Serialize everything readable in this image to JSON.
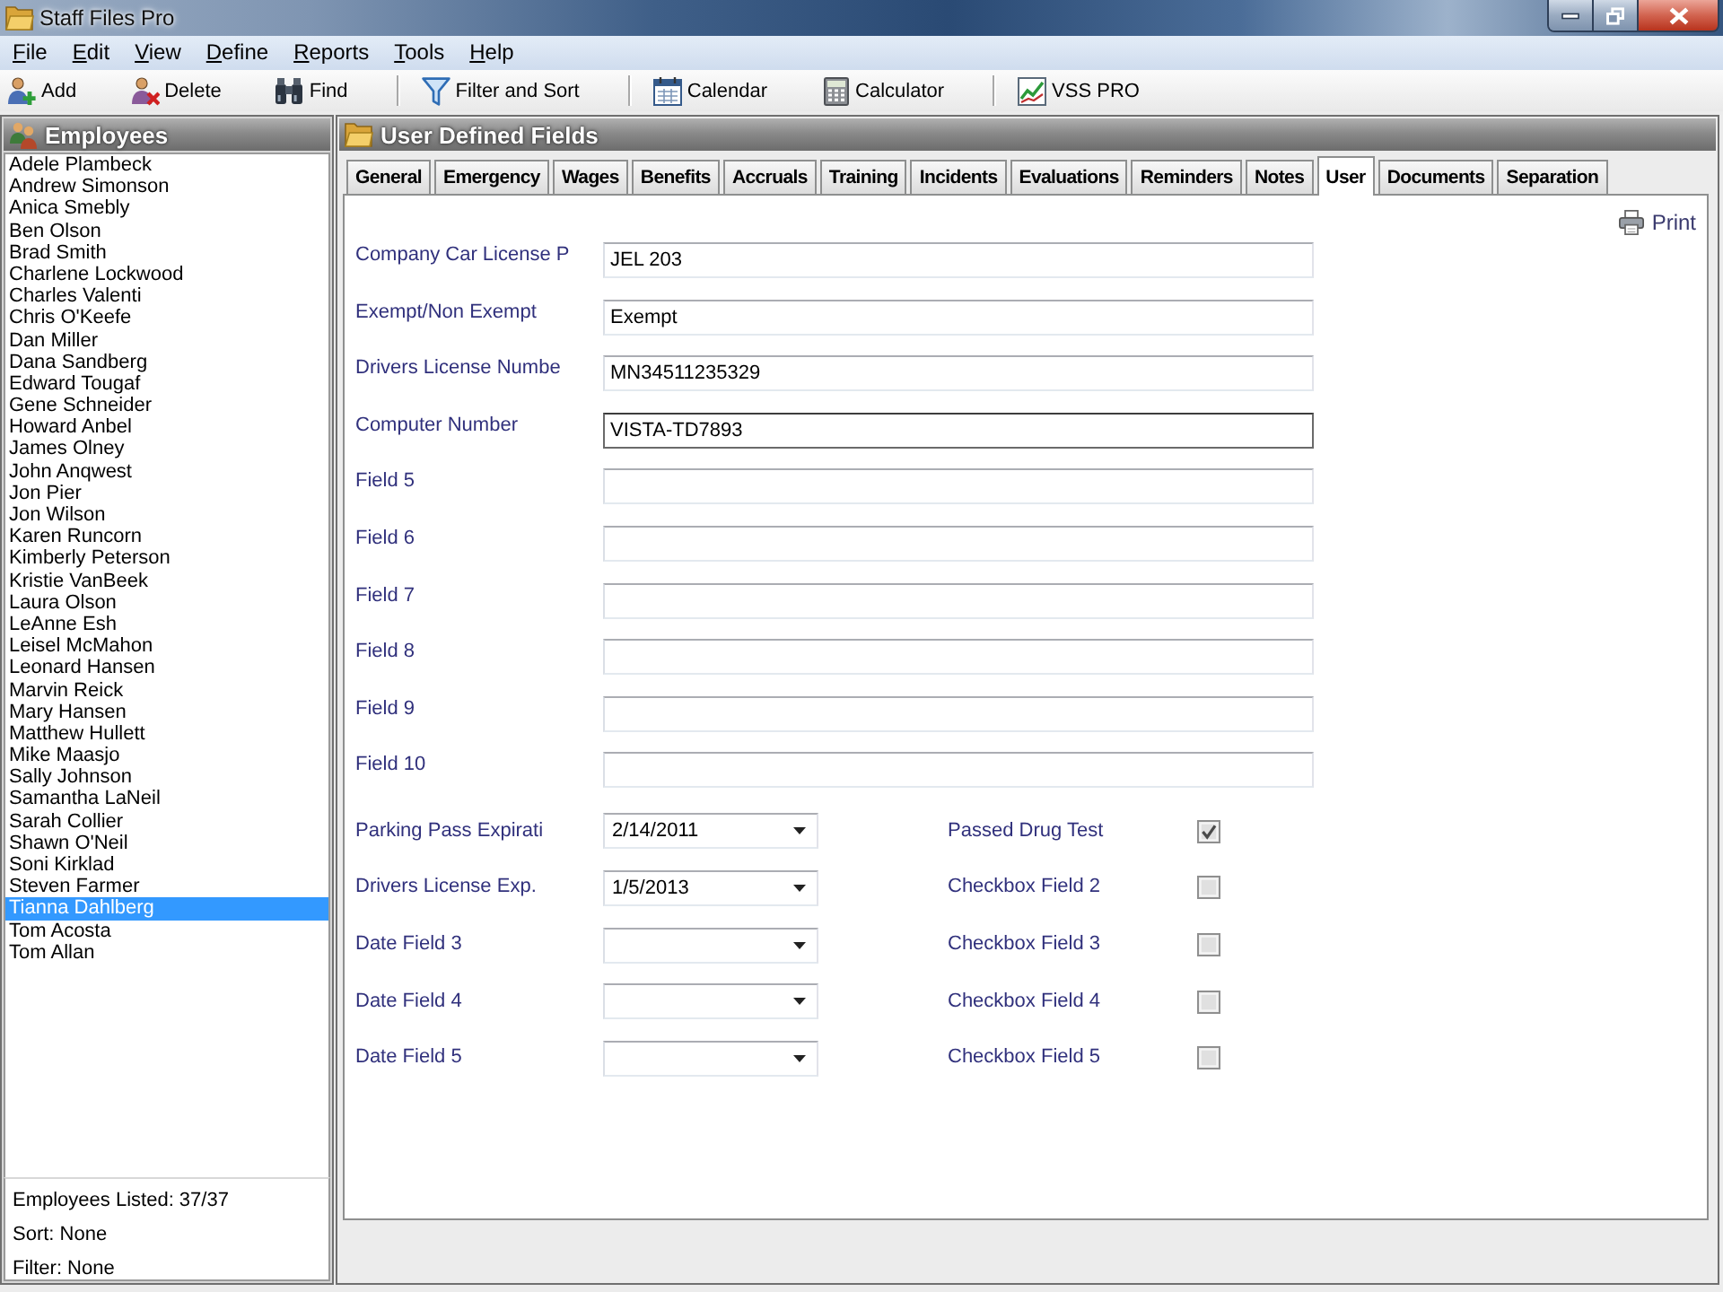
{
  "window": {
    "title": "Staff Files Pro"
  },
  "menu": [
    "File",
    "Edit",
    "View",
    "Define",
    "Reports",
    "Tools",
    "Help"
  ],
  "toolbar": [
    {
      "kind": "add",
      "label": "Add"
    },
    {
      "kind": "delete",
      "label": "Delete"
    },
    {
      "kind": "find",
      "label": "Find"
    },
    {
      "kind": "separator"
    },
    {
      "kind": "filter",
      "label": "Filter and Sort"
    },
    {
      "kind": "separator"
    },
    {
      "kind": "calendar",
      "label": "Calendar"
    },
    {
      "kind": "calculator",
      "label": "Calculator"
    },
    {
      "kind": "separator"
    },
    {
      "kind": "chart",
      "label": "VSS PRO"
    }
  ],
  "employees_panel": {
    "title": "Employees",
    "items": [
      {
        "name": "Adele Plambeck",
        "selected": false
      },
      {
        "name": "Andrew Simonson",
        "selected": false
      },
      {
        "name": "Anica Smebly",
        "selected": false
      },
      {
        "name": "Ben Olson",
        "selected": false
      },
      {
        "name": "Brad Smith",
        "selected": false
      },
      {
        "name": "Charlene Lockwood",
        "selected": false
      },
      {
        "name": "Charles Valenti",
        "selected": false
      },
      {
        "name": "Chris O'Keefe",
        "selected": false
      },
      {
        "name": "Dan Miller",
        "selected": false
      },
      {
        "name": "Dana Sandberg",
        "selected": false
      },
      {
        "name": "Edward Tougaf",
        "selected": false
      },
      {
        "name": "Gene Schneider",
        "selected": false
      },
      {
        "name": "Howard Anbel",
        "selected": false
      },
      {
        "name": "James Olney",
        "selected": false
      },
      {
        "name": "John Anqwest",
        "selected": false
      },
      {
        "name": "Jon Pier",
        "selected": false
      },
      {
        "name": "Jon Wilson",
        "selected": false
      },
      {
        "name": "Karen Runcorn",
        "selected": false
      },
      {
        "name": "Kimberly Peterson",
        "selected": false
      },
      {
        "name": "Kristie VanBeek",
        "selected": false
      },
      {
        "name": "Laura Olson",
        "selected": false
      },
      {
        "name": "LeAnne Esh",
        "selected": false
      },
      {
        "name": "Leisel McMahon",
        "selected": false
      },
      {
        "name": "Leonard Hansen",
        "selected": false
      },
      {
        "name": "Marvin Reick",
        "selected": false
      },
      {
        "name": "Mary Hansen",
        "selected": false
      },
      {
        "name": "Matthew Hullett",
        "selected": false
      },
      {
        "name": "Mike Maasjo",
        "selected": false
      },
      {
        "name": "Sally Johnson",
        "selected": false
      },
      {
        "name": "Samantha LaNeil",
        "selected": false
      },
      {
        "name": "Sarah Collier",
        "selected": false
      },
      {
        "name": "Shawn O'Neil",
        "selected": false
      },
      {
        "name": "Soni Kirklad",
        "selected": false
      },
      {
        "name": "Steven Farmer",
        "selected": false
      },
      {
        "name": "Tianna Dahlberg",
        "selected": true
      },
      {
        "name": "Tom Acosta",
        "selected": false
      },
      {
        "name": "Tom Allan",
        "selected": false
      }
    ],
    "status": [
      "Employees Listed: 37/37",
      "Sort: None",
      "Filter: None"
    ]
  },
  "details_panel": {
    "title": "User Defined Fields",
    "tabs": [
      {
        "label": "General",
        "selected": false
      },
      {
        "label": "Emergency",
        "selected": false
      },
      {
        "label": "Wages",
        "selected": false
      },
      {
        "label": "Benefits",
        "selected": false
      },
      {
        "label": "Accruals",
        "selected": false
      },
      {
        "label": "Training",
        "selected": false
      },
      {
        "label": "Incidents",
        "selected": false
      },
      {
        "label": "Evaluations",
        "selected": false
      },
      {
        "label": "Reminders",
        "selected": false
      },
      {
        "label": "Notes",
        "selected": false
      },
      {
        "label": "User",
        "selected": true
      },
      {
        "label": "Documents",
        "selected": false
      },
      {
        "label": "Separation",
        "selected": false
      }
    ],
    "print": "Print",
    "text_fields": [
      {
        "label": "Company Car License P",
        "value": "JEL 203",
        "focused": false
      },
      {
        "label": "Exempt/Non Exempt",
        "value": "Exempt",
        "focused": false
      },
      {
        "label": "Drivers License Numbe",
        "value": "MN34511235329",
        "focused": false
      },
      {
        "label": "Computer Number",
        "value": "VISTA-TD7893",
        "focused": true
      },
      {
        "label": "Field 5",
        "focused": false
      },
      {
        "label": "Field 6",
        "focused": false
      },
      {
        "label": "Field 7",
        "focused": false
      },
      {
        "label": "Field 8",
        "focused": false
      },
      {
        "label": "Field 9",
        "focused": false
      },
      {
        "label": "Field 10",
        "focused": false
      }
    ],
    "date_fields": [
      {
        "label": "Parking Pass Expirati",
        "value": "2/14/2011"
      },
      {
        "label": "Drivers License Exp.",
        "value": "1/5/2013"
      },
      {
        "label": "Date Field 3"
      },
      {
        "label": "Date Field 4"
      },
      {
        "label": "Date Field 5"
      }
    ],
    "checkbox_fields": [
      {
        "label": "Passed Drug Test",
        "checked": true
      },
      {
        "label": "Checkbox Field 2",
        "checked": false
      },
      {
        "label": "Checkbox Field 3",
        "checked": false
      },
      {
        "label": "Checkbox Field 4",
        "checked": false
      },
      {
        "label": "Checkbox Field 5",
        "checked": false
      }
    ]
  }
}
